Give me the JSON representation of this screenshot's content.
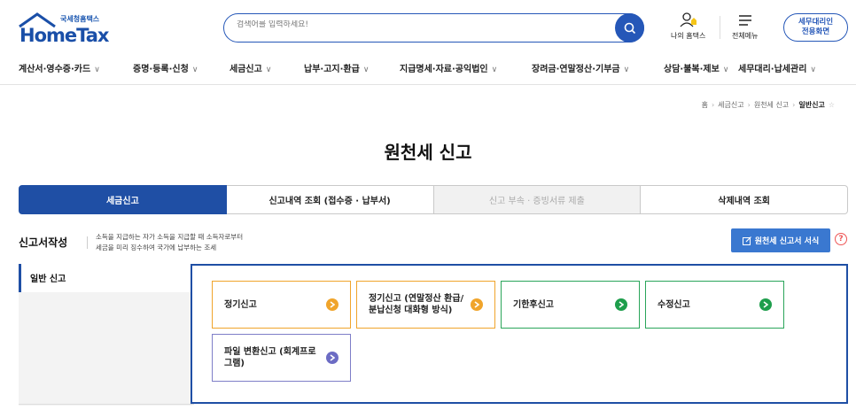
{
  "header": {
    "logo_small": "국세청홈택스",
    "logo_big": "HomeTax",
    "search_placeholder": "검색어를 입력하세요!",
    "my_hometax": "나의 홈택스",
    "all_menu": "전체메뉴",
    "agent_btn_line1": "세무대리인",
    "agent_btn_line2": "전용화면"
  },
  "nav": [
    {
      "label": "계산서·영수증·카드"
    },
    {
      "label": "증명·등록·신청"
    },
    {
      "label": "세금신고"
    },
    {
      "label": "납부·고지·환급"
    },
    {
      "label": "지급명세·자료·공익법인"
    },
    {
      "label": "장려금·연말정산·기부금"
    },
    {
      "label": "상담·불복·제보"
    },
    {
      "label": "세무대리·납세관리"
    }
  ],
  "breadcrumb": {
    "home": "홈",
    "level1": "세금신고",
    "level2": "원천세 신고",
    "current": "일반신고"
  },
  "page_title": "원천세 신고",
  "tabs": [
    {
      "label": "세금신고"
    },
    {
      "label": "신고내역 조회 (접수증 · 납부서)"
    },
    {
      "label": "신고 부속 · 증빙서류 제출"
    },
    {
      "label": "삭제내역 조회"
    }
  ],
  "section": {
    "title": "신고서작성",
    "desc_line1": "소득을 지급하는 자가 소득을 지급할 때 소득자로부터",
    "desc_line2": "세금을 미리 징수하여 국가에 납부하는 조세",
    "form_button": "원천세 신고서 서식",
    "help": "?"
  },
  "side": {
    "label": "일반 신고"
  },
  "cards": [
    {
      "label": "정기신고"
    },
    {
      "label": "정기신고 (연말정산 환급/분납신청 대화형 방식)"
    },
    {
      "label": "기한후신고"
    },
    {
      "label": "수정신고"
    },
    {
      "label": "파일 변환신고 (회계프로그램)"
    }
  ],
  "colors": {
    "brand": "#1f4fa5",
    "orange": "#f0a42b",
    "green": "#1e9e4c",
    "purple": "#6c6cc4"
  }
}
